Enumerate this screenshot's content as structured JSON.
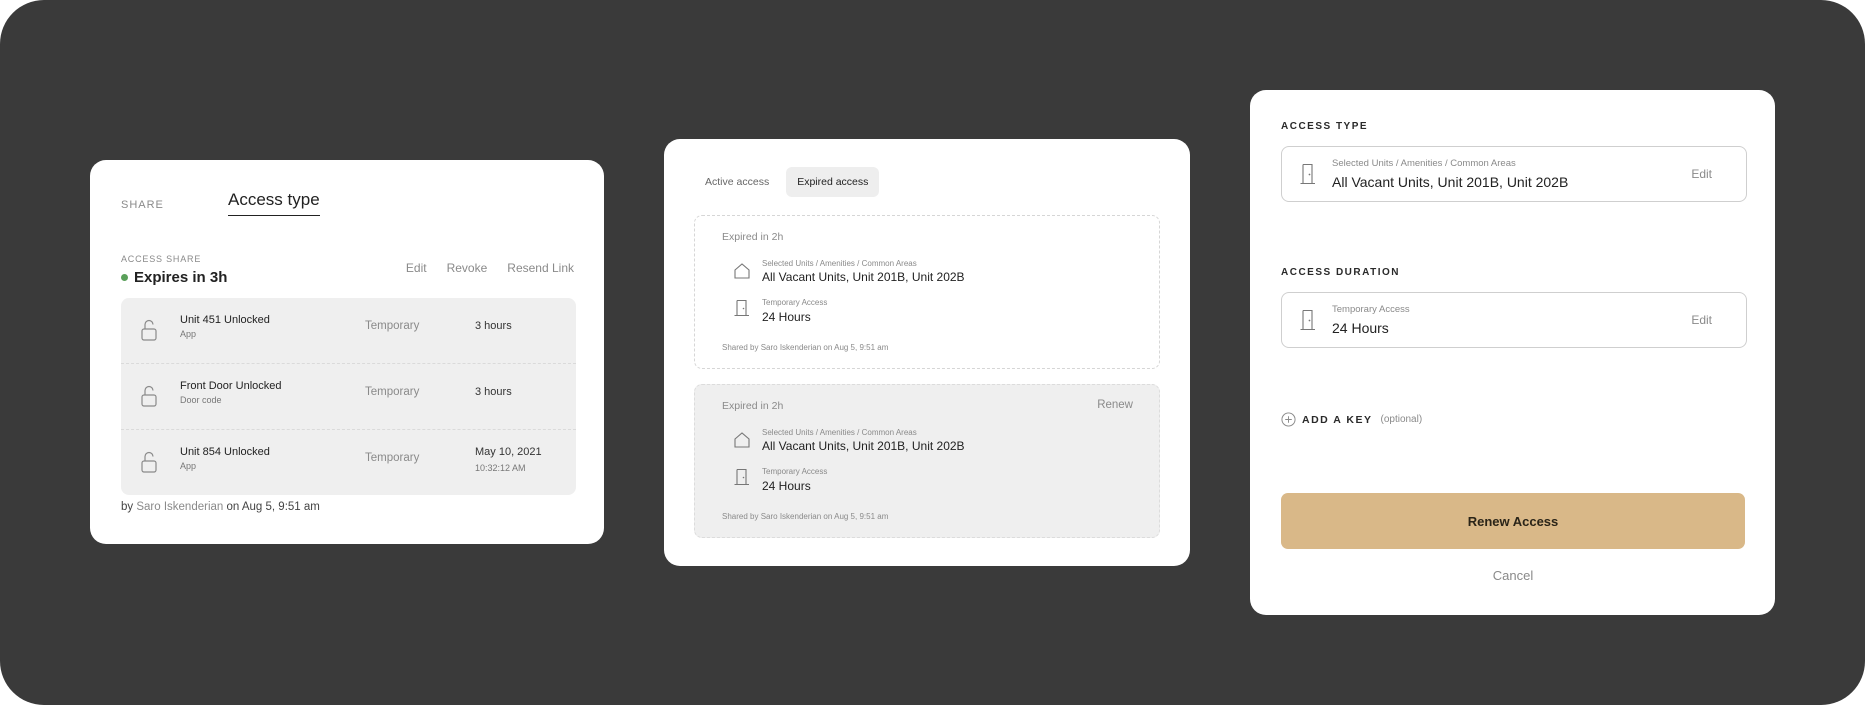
{
  "card1": {
    "tabs": {
      "share": "SHARE",
      "access_type": "Access type"
    },
    "eyebrow": "ACCESS SHARE",
    "status": "Expires in 3h",
    "status_color": "#5aa05a",
    "actions": {
      "edit": "Edit",
      "revoke": "Revoke",
      "resend": "Resend Link"
    },
    "rows": [
      {
        "name": "Unit 451 Unlocked",
        "method": "App",
        "type": "Temporary",
        "duration": "3 hours"
      },
      {
        "name": "Front Door Unlocked",
        "method": "Door code",
        "type": "Temporary",
        "duration": "3 hours"
      },
      {
        "name": "Unit 854 Unlocked",
        "method": "App",
        "type": "Temporary",
        "date": "May 10, 2021",
        "time": "10:32:12 AM"
      }
    ],
    "footer": {
      "by": "by",
      "name": "Saro Iskenderian",
      "on": "on Aug 5, 9:51 am"
    }
  },
  "card2": {
    "tabs": {
      "active": "Active access",
      "expired": "Expired access"
    },
    "entries": [
      {
        "expired": "Expired in 2h",
        "units_label": "Selected Units / Amenities / Common Areas",
        "units_value": "All Vacant Units, Unit 201B, Unit 202B",
        "duration_label": "Temporary Access",
        "duration_value": "24 Hours",
        "shared_prefix": "Shared by",
        "shared_name": "Saro Iskenderian",
        "shared_date": "on  Aug 5, 9:51 am"
      },
      {
        "expired": "Expired in 2h",
        "renew": "Renew",
        "units_label": "Selected Units / Amenities / Common Areas",
        "units_value": "All Vacant Units, Unit 201B, Unit 202B",
        "duration_label": "Temporary Access",
        "duration_value": "24 Hours",
        "shared_prefix": "Shared by",
        "shared_name": "Saro Iskenderian",
        "shared_date": "on  Aug 5, 9:51 am"
      }
    ]
  },
  "card3": {
    "access_type": {
      "heading": "ACCESS TYPE",
      "label": "Selected Units / Amenities / Common Areas",
      "value": "All Vacant Units, Unit 201B, Unit 202B",
      "edit": "Edit"
    },
    "access_duration": {
      "heading": "ACCESS DURATION",
      "label": "Temporary Access",
      "value": "24 Hours",
      "edit": "Edit"
    },
    "add_key": {
      "label": "ADD A KEY",
      "optional": "(optional)"
    },
    "renew_button": "Renew Access",
    "renew_color": "#d9b888",
    "cancel": "Cancel"
  }
}
